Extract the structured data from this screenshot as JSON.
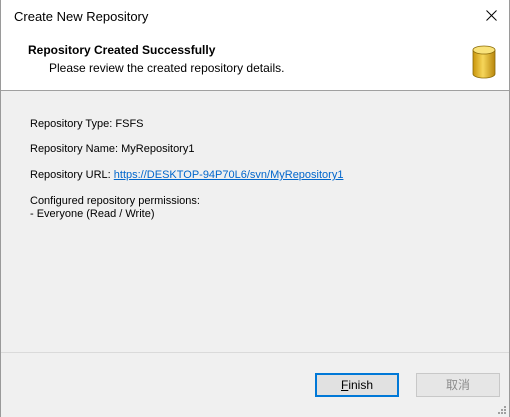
{
  "window": {
    "title": "Create New Repository"
  },
  "header": {
    "title": "Repository Created Successfully",
    "subtitle": "Please review the created repository details.",
    "icon": "database-icon",
    "icon_color": "#e8b81c"
  },
  "details": {
    "type_label": "Repository Type:",
    "type_value": "FSFS",
    "name_label": "Repository Name:",
    "name_value": "MyRepository1",
    "url_label": "Repository URL:",
    "url_value": "https://DESKTOP-94P70L6/svn/MyRepository1",
    "permissions_label": "Configured repository permissions:",
    "permissions": [
      "- Everyone (Read / Write)"
    ]
  },
  "buttons": {
    "finish": "Finish",
    "cancel": "取消"
  },
  "colors": {
    "link": "#0066cc",
    "accent": "#0078d7"
  }
}
